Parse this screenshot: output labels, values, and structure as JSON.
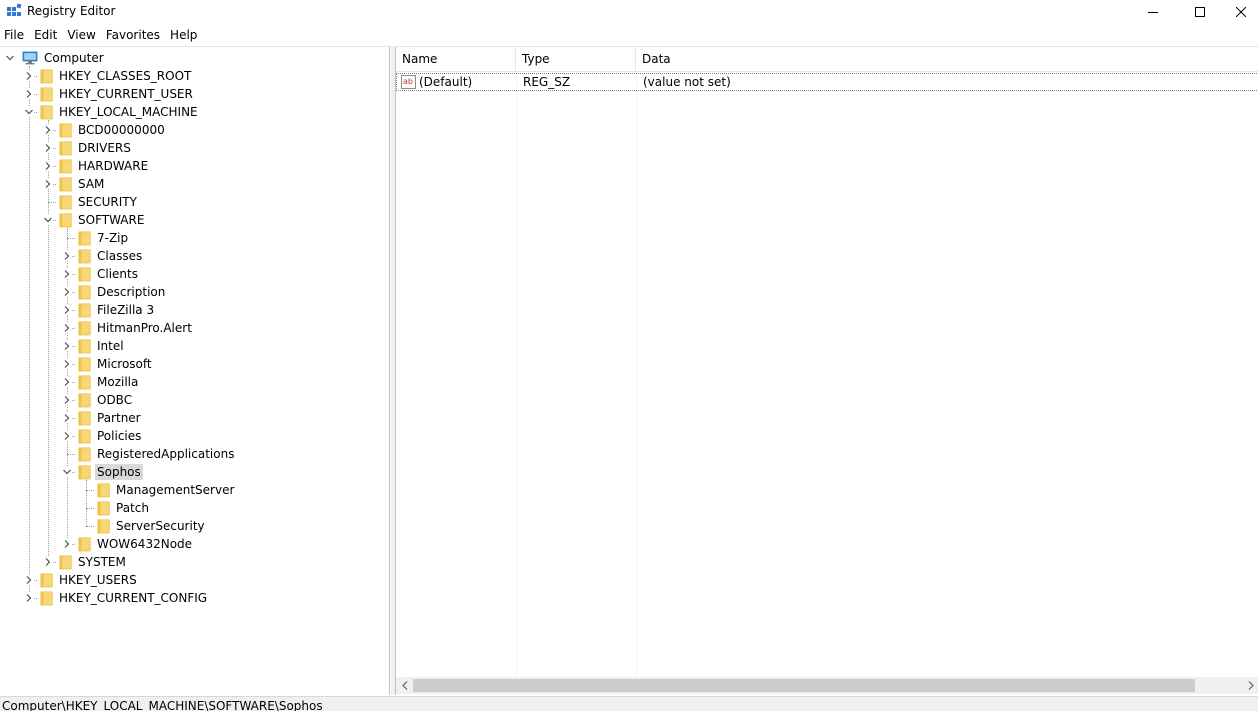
{
  "window": {
    "title": "Registry Editor",
    "icon": "registry-editor-icon"
  },
  "menu": [
    "File",
    "Edit",
    "View",
    "Favorites",
    "Help"
  ],
  "tree": [
    {
      "label": "Computer",
      "depth": 0,
      "expander": "expanded",
      "icon": "computer-icon"
    },
    {
      "label": "HKEY_CLASSES_ROOT",
      "depth": 1,
      "expander": "collapsed",
      "icon": "folder-icon"
    },
    {
      "label": "HKEY_CURRENT_USER",
      "depth": 1,
      "expander": "collapsed",
      "icon": "folder-icon"
    },
    {
      "label": "HKEY_LOCAL_MACHINE",
      "depth": 1,
      "expander": "expanded",
      "icon": "folder-icon"
    },
    {
      "label": "BCD00000000",
      "depth": 2,
      "expander": "collapsed",
      "icon": "folder-icon"
    },
    {
      "label": "DRIVERS",
      "depth": 2,
      "expander": "collapsed",
      "icon": "folder-icon"
    },
    {
      "label": "HARDWARE",
      "depth": 2,
      "expander": "collapsed",
      "icon": "folder-icon"
    },
    {
      "label": "SAM",
      "depth": 2,
      "expander": "collapsed",
      "icon": "folder-icon"
    },
    {
      "label": "SECURITY",
      "depth": 2,
      "expander": "none",
      "icon": "folder-icon"
    },
    {
      "label": "SOFTWARE",
      "depth": 2,
      "expander": "expanded",
      "icon": "folder-icon"
    },
    {
      "label": "7-Zip",
      "depth": 3,
      "expander": "none",
      "icon": "folder-icon"
    },
    {
      "label": "Classes",
      "depth": 3,
      "expander": "collapsed",
      "icon": "folder-icon"
    },
    {
      "label": "Clients",
      "depth": 3,
      "expander": "collapsed",
      "icon": "folder-icon"
    },
    {
      "label": "Description",
      "depth": 3,
      "expander": "collapsed",
      "icon": "folder-icon"
    },
    {
      "label": "FileZilla 3",
      "depth": 3,
      "expander": "collapsed",
      "icon": "folder-icon"
    },
    {
      "label": "HitmanPro.Alert",
      "depth": 3,
      "expander": "collapsed",
      "icon": "folder-icon"
    },
    {
      "label": "Intel",
      "depth": 3,
      "expander": "collapsed",
      "icon": "folder-icon"
    },
    {
      "label": "Microsoft",
      "depth": 3,
      "expander": "collapsed",
      "icon": "folder-icon"
    },
    {
      "label": "Mozilla",
      "depth": 3,
      "expander": "collapsed",
      "icon": "folder-icon"
    },
    {
      "label": "ODBC",
      "depth": 3,
      "expander": "collapsed",
      "icon": "folder-icon"
    },
    {
      "label": "Partner",
      "depth": 3,
      "expander": "collapsed",
      "icon": "folder-icon"
    },
    {
      "label": "Policies",
      "depth": 3,
      "expander": "collapsed",
      "icon": "folder-icon"
    },
    {
      "label": "RegisteredApplications",
      "depth": 3,
      "expander": "none",
      "icon": "folder-icon"
    },
    {
      "label": "Sophos",
      "depth": 3,
      "expander": "expanded",
      "icon": "folder-icon",
      "selected": true
    },
    {
      "label": "ManagementServer",
      "depth": 4,
      "expander": "none",
      "icon": "folder-icon"
    },
    {
      "label": "Patch",
      "depth": 4,
      "expander": "none",
      "icon": "folder-icon"
    },
    {
      "label": "ServerSecurity",
      "depth": 4,
      "expander": "none",
      "icon": "folder-icon"
    },
    {
      "label": "WOW6432Node",
      "depth": 3,
      "expander": "collapsed",
      "icon": "folder-icon"
    },
    {
      "label": "SYSTEM",
      "depth": 2,
      "expander": "collapsed",
      "icon": "folder-icon"
    },
    {
      "label": "HKEY_USERS",
      "depth": 1,
      "expander": "collapsed",
      "icon": "folder-icon"
    },
    {
      "label": "HKEY_CURRENT_CONFIG",
      "depth": 1,
      "expander": "collapsed",
      "icon": "folder-icon"
    }
  ],
  "list": {
    "columns": [
      "Name",
      "Type",
      "Data"
    ],
    "rows": [
      {
        "icon": "string-value-icon",
        "name": "(Default)",
        "type": "REG_SZ",
        "data": "(value not set)"
      }
    ]
  },
  "status": {
    "path": "Computer\\HKEY_LOCAL_MACHINE\\SOFTWARE\\Sophos"
  },
  "colors": {
    "folder": "#f8d775",
    "folder_dark": "#e8b931",
    "selection": "#d9d9d9",
    "computer_icon": "#3c8fd6"
  }
}
